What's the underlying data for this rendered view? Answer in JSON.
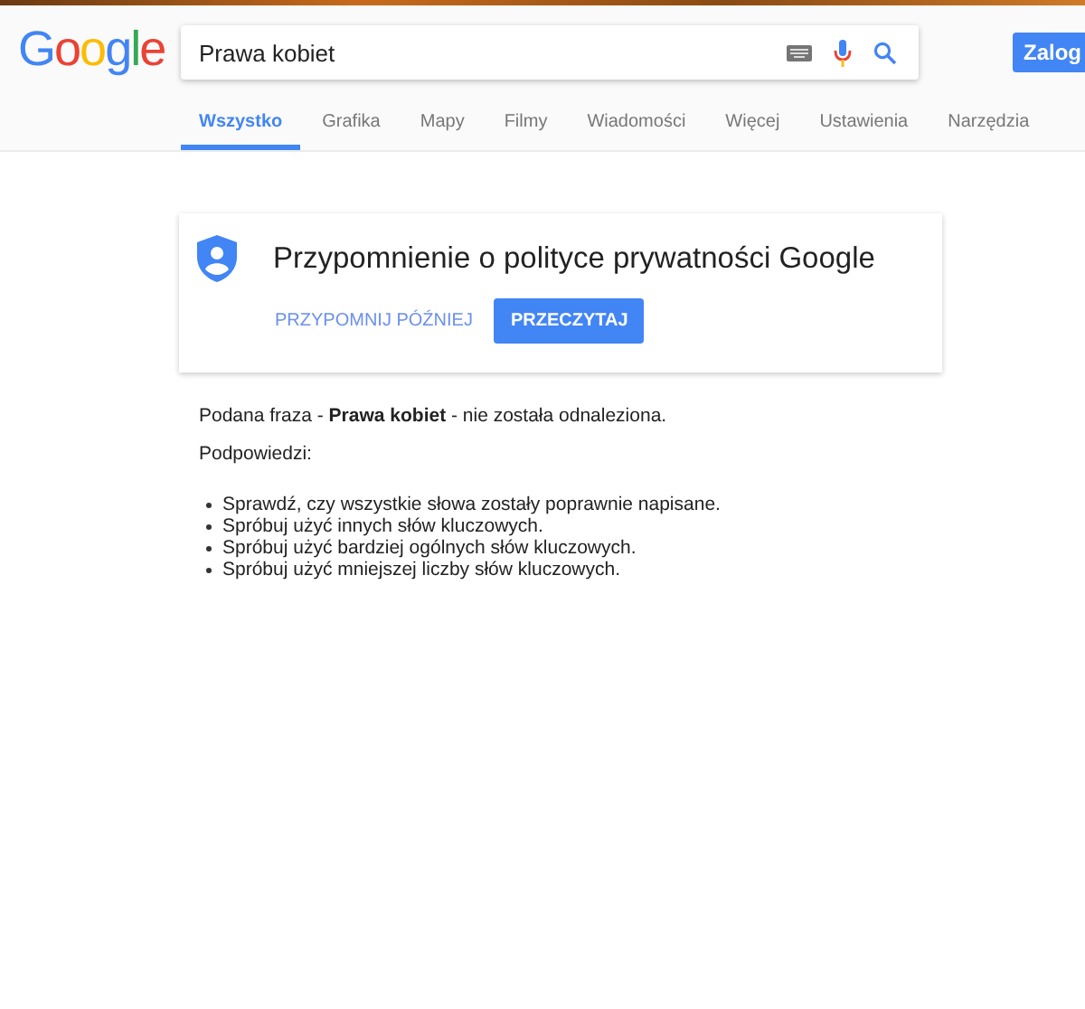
{
  "logo": "Google",
  "search": {
    "value": "Prawa kobiet"
  },
  "signin_button": "Zalog",
  "tabs": [
    {
      "label": "Wszystko",
      "selected": true
    },
    {
      "label": "Grafika",
      "selected": false
    },
    {
      "label": "Mapy",
      "selected": false
    },
    {
      "label": "Filmy",
      "selected": false
    },
    {
      "label": "Wiadomości",
      "selected": false
    },
    {
      "label": "Więcej",
      "selected": false
    },
    {
      "label": "Ustawienia",
      "selected": false
    },
    {
      "label": "Narzędzia",
      "selected": false
    }
  ],
  "privacy_card": {
    "title": "Przypomnienie o polityce prywatności Google",
    "buttons": [
      {
        "label": "PRZYPOMNIJ PÓŹNIEJ",
        "kind": "flat"
      },
      {
        "label": "PRZECZYTAJ",
        "kind": "raised"
      }
    ]
  },
  "message": "Podana fraza - **Prawa kobiet** - nie została odnaleziona.",
  "hints_title": "Podpowiedzi:",
  "hints": [
    "Sprawdź, czy wszystkie słowa zostały poprawnie napisane.",
    "Spróbuj użyć innych słów kluczowych.",
    "Spróbuj użyć bardziej ogólnych słów kluczowych.",
    "Spróbuj użyć mniejszej liczby słów kluczowych."
  ]
}
